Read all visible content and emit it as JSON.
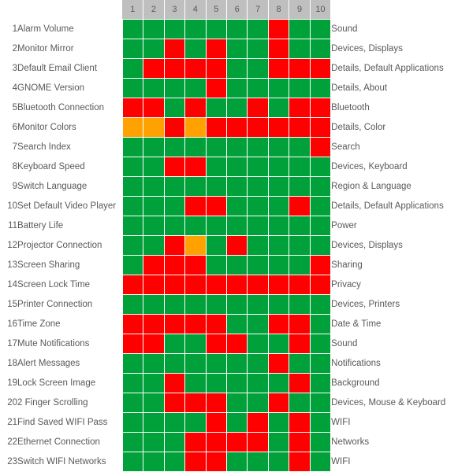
{
  "legend_colors": {
    "pass": "#00a03a",
    "fail": "#fe0000",
    "partial": "#ffa200",
    "header_bg": "#bfbfbf",
    "text": "#595959",
    "gridline": "#ffffff"
  },
  "columns": {
    "row_number_header": "",
    "task_header": "",
    "location_header": "",
    "trials": [
      "1",
      "2",
      "3",
      "4",
      "5",
      "6",
      "7",
      "8",
      "9",
      "10"
    ]
  },
  "rows": [
    {
      "num": "1",
      "task": "Alarm Volume",
      "location": "Sound",
      "cells": [
        "g",
        "g",
        "g",
        "g",
        "g",
        "g",
        "g",
        "r",
        "g",
        "g"
      ]
    },
    {
      "num": "2",
      "task": "Monitor Mirror",
      "location": "Devices, Displays",
      "cells": [
        "g",
        "g",
        "r",
        "g",
        "r",
        "g",
        "g",
        "r",
        "g",
        "g"
      ]
    },
    {
      "num": "3",
      "task": "Default Email Client",
      "location": "Details, Default Applications",
      "cells": [
        "g",
        "r",
        "r",
        "r",
        "r",
        "g",
        "g",
        "r",
        "r",
        "r"
      ]
    },
    {
      "num": "4",
      "task": "GNOME Version",
      "location": "Details, About",
      "cells": [
        "g",
        "g",
        "g",
        "g",
        "r",
        "g",
        "g",
        "g",
        "g",
        "g"
      ]
    },
    {
      "num": "5",
      "task": "Bluetooth Connection",
      "location": "Bluetooth",
      "cells": [
        "r",
        "r",
        "g",
        "r",
        "g",
        "g",
        "r",
        "g",
        "r",
        "r"
      ]
    },
    {
      "num": "6",
      "task": "Monitor Colors",
      "location": "Details, Color",
      "cells": [
        "o",
        "o",
        "r",
        "o",
        "r",
        "r",
        "r",
        "r",
        "r",
        "r"
      ]
    },
    {
      "num": "7",
      "task": "Search Index",
      "location": "Search",
      "cells": [
        "g",
        "g",
        "g",
        "g",
        "g",
        "g",
        "g",
        "g",
        "g",
        "r"
      ]
    },
    {
      "num": "8",
      "task": "Keyboard Speed",
      "location": "Devices, Keyboard",
      "cells": [
        "g",
        "g",
        "r",
        "r",
        "g",
        "g",
        "g",
        "g",
        "g",
        "g"
      ]
    },
    {
      "num": "9",
      "task": "Switch Language",
      "location": "Region & Language",
      "cells": [
        "g",
        "g",
        "g",
        "g",
        "g",
        "g",
        "g",
        "g",
        "g",
        "g"
      ]
    },
    {
      "num": "10",
      "task": "Set Default Video Player",
      "location": "Details, Default Applications",
      "cells": [
        "g",
        "g",
        "g",
        "r",
        "r",
        "g",
        "g",
        "g",
        "r",
        "g"
      ]
    },
    {
      "num": "11",
      "task": "Battery Life",
      "location": "Power",
      "cells": [
        "g",
        "g",
        "g",
        "g",
        "g",
        "g",
        "g",
        "g",
        "g",
        "g"
      ]
    },
    {
      "num": "12",
      "task": "Projector Connection",
      "location": "Devices, Displays",
      "cells": [
        "g",
        "g",
        "r",
        "o",
        "g",
        "r",
        "g",
        "g",
        "g",
        "g"
      ]
    },
    {
      "num": "13",
      "task": "Screen Sharing",
      "location": "Sharing",
      "cells": [
        "g",
        "r",
        "r",
        "r",
        "g",
        "g",
        "g",
        "g",
        "g",
        "r"
      ]
    },
    {
      "num": "14",
      "task": "Screen Lock Time",
      "location": "Privacy",
      "cells": [
        "r",
        "r",
        "r",
        "r",
        "r",
        "r",
        "r",
        "r",
        "r",
        "r"
      ]
    },
    {
      "num": "15",
      "task": "Printer Connection",
      "location": "Devices, Printers",
      "cells": [
        "g",
        "g",
        "g",
        "g",
        "g",
        "g",
        "g",
        "g",
        "g",
        "g"
      ]
    },
    {
      "num": "16",
      "task": "Time Zone",
      "location": "Date & Time",
      "cells": [
        "r",
        "r",
        "r",
        "r",
        "r",
        "g",
        "g",
        "r",
        "r",
        "g"
      ]
    },
    {
      "num": "17",
      "task": "Mute Notifications",
      "location": "Sound",
      "cells": [
        "r",
        "r",
        "g",
        "g",
        "r",
        "r",
        "g",
        "g",
        "r",
        "g"
      ]
    },
    {
      "num": "18",
      "task": "Alert Messages",
      "location": "Notifications",
      "cells": [
        "g",
        "g",
        "g",
        "g",
        "g",
        "g",
        "g",
        "r",
        "g",
        "g"
      ]
    },
    {
      "num": "19",
      "task": "Lock Screen Image",
      "location": "Background",
      "cells": [
        "g",
        "g",
        "r",
        "g",
        "g",
        "g",
        "g",
        "g",
        "r",
        "g"
      ]
    },
    {
      "num": "20",
      "task": "2 Finger Scrolling",
      "location": "Devices, Mouse & Keyboard",
      "cells": [
        "g",
        "g",
        "r",
        "r",
        "r",
        "g",
        "g",
        "r",
        "g",
        "g"
      ]
    },
    {
      "num": "21",
      "task": "Find Saved WIFI Pass",
      "location": "WIFI",
      "cells": [
        "g",
        "g",
        "g",
        "g",
        "r",
        "g",
        "r",
        "g",
        "r",
        "g"
      ]
    },
    {
      "num": "22",
      "task": "Ethernet Connection",
      "location": "Networks",
      "cells": [
        "g",
        "g",
        "g",
        "r",
        "r",
        "r",
        "r",
        "g",
        "r",
        "g"
      ]
    },
    {
      "num": "23",
      "task": "Switch WIFI Networks",
      "location": "WIFI",
      "cells": [
        "g",
        "g",
        "g",
        "r",
        "r",
        "g",
        "g",
        "g",
        "r",
        "g"
      ]
    }
  ]
}
